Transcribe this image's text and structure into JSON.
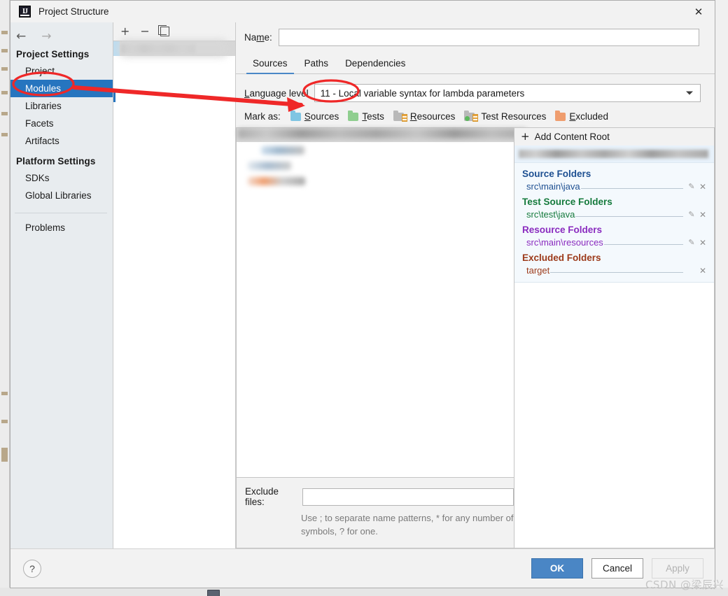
{
  "window": {
    "title": "Project Structure",
    "app_icon": "intellij-idea-icon",
    "close_icon": "close-icon"
  },
  "nav": {
    "back_icon": "arrow-left-icon",
    "forward_icon": "arrow-right-icon",
    "groups": [
      {
        "title": "Project Settings",
        "items": [
          {
            "label": "Project",
            "selected": false
          },
          {
            "label": "Modules",
            "selected": true
          },
          {
            "label": "Libraries",
            "selected": false
          },
          {
            "label": "Facets",
            "selected": false
          },
          {
            "label": "Artifacts",
            "selected": false
          }
        ]
      },
      {
        "title": "Platform Settings",
        "items": [
          {
            "label": "SDKs",
            "selected": false
          },
          {
            "label": "Global Libraries",
            "selected": false
          }
        ]
      }
    ],
    "problems_label": "Problems"
  },
  "module_list": {
    "toolbar": {
      "add_icon": "plus-icon",
      "remove_icon": "minus-icon",
      "copy_icon": "copy-icon"
    },
    "selected_row_redacted": true
  },
  "module_editor": {
    "name_label": "Name:",
    "name_value": "",
    "name_redacted": true,
    "tabs": [
      {
        "label": "Sources",
        "active": true
      },
      {
        "label": "Paths",
        "active": false
      },
      {
        "label": "Dependencies",
        "active": false
      }
    ],
    "language_level": {
      "label": "Language level",
      "value": "11 - Local variable syntax for lambda parameters",
      "caret_icon": "chevron-down-icon"
    },
    "mark_as": {
      "label": "Mark as:",
      "options": [
        {
          "label": "Sources",
          "color": "#7fc5e3",
          "icon": "folder-sources-icon"
        },
        {
          "label": "Tests",
          "color": "#8fce8f",
          "icon": "folder-tests-icon"
        },
        {
          "label": "Resources",
          "color": "#b9b9b9",
          "icon": "folder-resources-icon"
        },
        {
          "label": "Test Resources",
          "color": "#b9b9b9",
          "icon": "folder-test-resources-icon"
        },
        {
          "label": "Excluded",
          "color": "#ef9d6e",
          "icon": "folder-excluded-icon"
        }
      ]
    },
    "exclude": {
      "label": "Exclude files:",
      "value": "",
      "hint_line1": "Use ; to separate name patterns, * for any number of",
      "hint_line2": "symbols, ? for one."
    }
  },
  "content_roots": {
    "add_label": "Add Content Root",
    "add_icon": "plus-icon",
    "root_path_redacted": true,
    "groups": [
      {
        "title": "Source Folders",
        "color": "#1d4f91",
        "kind": "src",
        "entries": [
          {
            "path": "src\\main\\java",
            "edit_icon": "pencil-icon",
            "remove_icon": "close-icon"
          }
        ]
      },
      {
        "title": "Test Source Folders",
        "color": "#157a3c",
        "kind": "test",
        "entries": [
          {
            "path": "src\\test\\java",
            "edit_icon": "pencil-icon",
            "remove_icon": "close-icon"
          }
        ]
      },
      {
        "title": "Resource Folders",
        "color": "#8a2bbf",
        "kind": "res",
        "entries": [
          {
            "path": "src\\main\\resources",
            "edit_icon": "pencil-icon",
            "remove_icon": "close-icon"
          }
        ]
      },
      {
        "title": "Excluded Folders",
        "color": "#9c3a1a",
        "kind": "excl",
        "entries": [
          {
            "path": "target",
            "edit_icon": "",
            "remove_icon": "close-icon"
          }
        ]
      }
    ]
  },
  "footer": {
    "help_label": "?",
    "ok_label": "OK",
    "cancel_label": "Cancel",
    "apply_label": "Apply",
    "apply_disabled": true
  },
  "annotations": {
    "ellipse_modules": "red-ellipse-around-modules",
    "ellipse_language_level": "red-ellipse-around-language-level-value",
    "arrow": "red-arrow-pointing-to-language-level",
    "color": "#ef2828"
  },
  "watermark": {
    "text": "CSDN @梁辰兴"
  }
}
